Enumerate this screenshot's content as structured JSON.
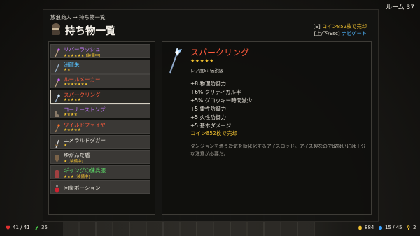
{
  "room": "ルーム 37",
  "breadcrumb": "放浪商人 → 持ち物一覧",
  "title": "持ち物一覧",
  "hints": {
    "sell_key": "[E]",
    "sell_text": "コイン852枚で売却",
    "nav_key": "[上/下/Esc]",
    "nav_text": "ナビゲート"
  },
  "items": [
    {
      "name": "リバーラッシュ",
      "color": "#c77dff",
      "stars": "★★★★★★",
      "tag": "[装備中]",
      "icon": "staff-icon"
    },
    {
      "name": "洲龍朱",
      "color": "#56c2ff",
      "stars": "★★",
      "tag": "",
      "icon": "wand-icon"
    },
    {
      "name": "ルールメーカー",
      "color": "#ff5a3c",
      "stars": "★★★★★★★",
      "tag": "",
      "icon": "staff-icon"
    },
    {
      "name": "スパークリング",
      "color": "#ff5a3c",
      "stars": "★★★★★",
      "tag": "",
      "icon": "ice-staff-icon"
    },
    {
      "name": "コーナーストンプ",
      "color": "#c77dff",
      "stars": "★★★★",
      "tag": "",
      "icon": "boot-icon"
    },
    {
      "name": "ワイルドファイヤ",
      "color": "#ff5a3c",
      "stars": "★★★★★",
      "tag": "",
      "icon": "fire-staff-icon"
    },
    {
      "name": "エメラルドダガー",
      "color": "#ece8df",
      "stars": "★",
      "tag": "",
      "icon": "dagger-icon"
    },
    {
      "name": "ゆがんだ盾",
      "color": "#ece8df",
      "stars": "★",
      "tag": "[装備中]",
      "icon": "shield-icon"
    },
    {
      "name": "ギャングの傭兵服",
      "color": "#5ee06a",
      "stars": "★★★",
      "tag": "[装備中]",
      "icon": "armor-icon"
    },
    {
      "name": "回復ポーション",
      "color": "#ece8df",
      "stars": "",
      "tag": "",
      "icon": "potion-icon"
    }
  ],
  "selected_index": 3,
  "detail": {
    "name": "スパークリング",
    "stars": "★★★★★",
    "rarity": "レア度5: 伝説級",
    "stats": [
      "+8 物理防御力",
      "+6% クリティカル率",
      "+5% グロッキー時間減少",
      "+5 雷性防御力",
      "+5 火性防御力",
      "+5 基本ダメージ"
    ],
    "sell": "コイン852枚で売却",
    "description": "ダンジョンを漂う冷気を動化化するアイスロッド。アイス製なので取扱いには十分な注意が必要だ。"
  },
  "hud": {
    "hp": "41 / 41",
    "stamina": "35",
    "coins": "884",
    "mana": "15 / 45",
    "keys": "2"
  },
  "colors": {
    "gold": "#f0c030",
    "legendary": "#ff5a3c",
    "epic": "#c77dff",
    "rare": "#56c2ff",
    "uncommon": "#5ee06a"
  }
}
